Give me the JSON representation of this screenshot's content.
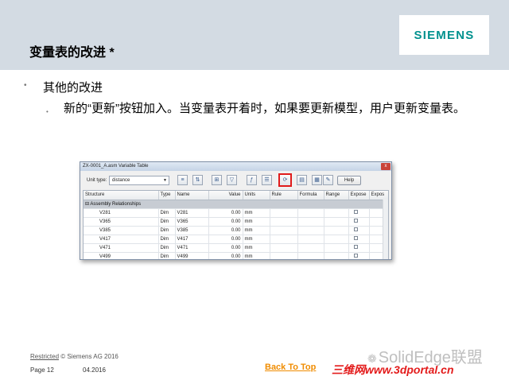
{
  "slide": {
    "title": "变量表的改进 *",
    "logo": "SIEMENS",
    "bullet_level1": "其他的改进",
    "bullet_level2": "新的“更新”按钮加入。当变量表开着时，如果要更新模型，用户更新变量表。",
    "bullet_glyph_1": "•",
    "bullet_glyph_2": "•"
  },
  "window": {
    "title": "ZX-0001_A.asm Variable Table",
    "close_label": "x",
    "unit_label": "Unit type:",
    "unit_value": "distance",
    "dropdown_arrow": "▼",
    "toolbar_icons": [
      "filter-icon",
      "sort-icon",
      "relations-icon",
      "funnel-icon",
      "formula-icon",
      "update-icon",
      "print-icon",
      "export-icon",
      "edit-icon"
    ],
    "help_label": "Help",
    "columns": [
      "Structure",
      "Type",
      "Name",
      "Value",
      "Units",
      "Rule",
      "Formula",
      "Range",
      "Expose",
      "Expos"
    ],
    "group_row": "Assembly Relationships",
    "rows": [
      {
        "structure": "V281",
        "type": "Dim",
        "name": "V281",
        "value": "0.00",
        "units": "mm"
      },
      {
        "structure": "V365",
        "type": "Dim",
        "name": "V365",
        "value": "0.00",
        "units": "mm"
      },
      {
        "structure": "V385",
        "type": "Dim",
        "name": "V385",
        "value": "0.00",
        "units": "mm"
      },
      {
        "structure": "V417",
        "type": "Dim",
        "name": "V417",
        "value": "0.00",
        "units": "mm"
      },
      {
        "structure": "V471",
        "type": "Dim",
        "name": "V471",
        "value": "0.00",
        "units": "mm"
      },
      {
        "structure": "V499",
        "type": "Dim",
        "name": "V499",
        "value": "0.00",
        "units": "mm"
      }
    ],
    "highlight_color": "#e01b1b"
  },
  "footer": {
    "restricted": "Restricted",
    "copyright": " © Siemens AG 2016",
    "page": "Page 12",
    "date": "04.2016",
    "back_to_top": "Back To Top",
    "watermark_1": "SolidEdge联盟",
    "watermark_2": "三维网www.3dportal.cn"
  },
  "colors": {
    "header_band": "#d3dbe3",
    "siemens_teal": "#00918e",
    "back_to_top": "#f08c00",
    "watermark_red": "#e31b1b"
  }
}
